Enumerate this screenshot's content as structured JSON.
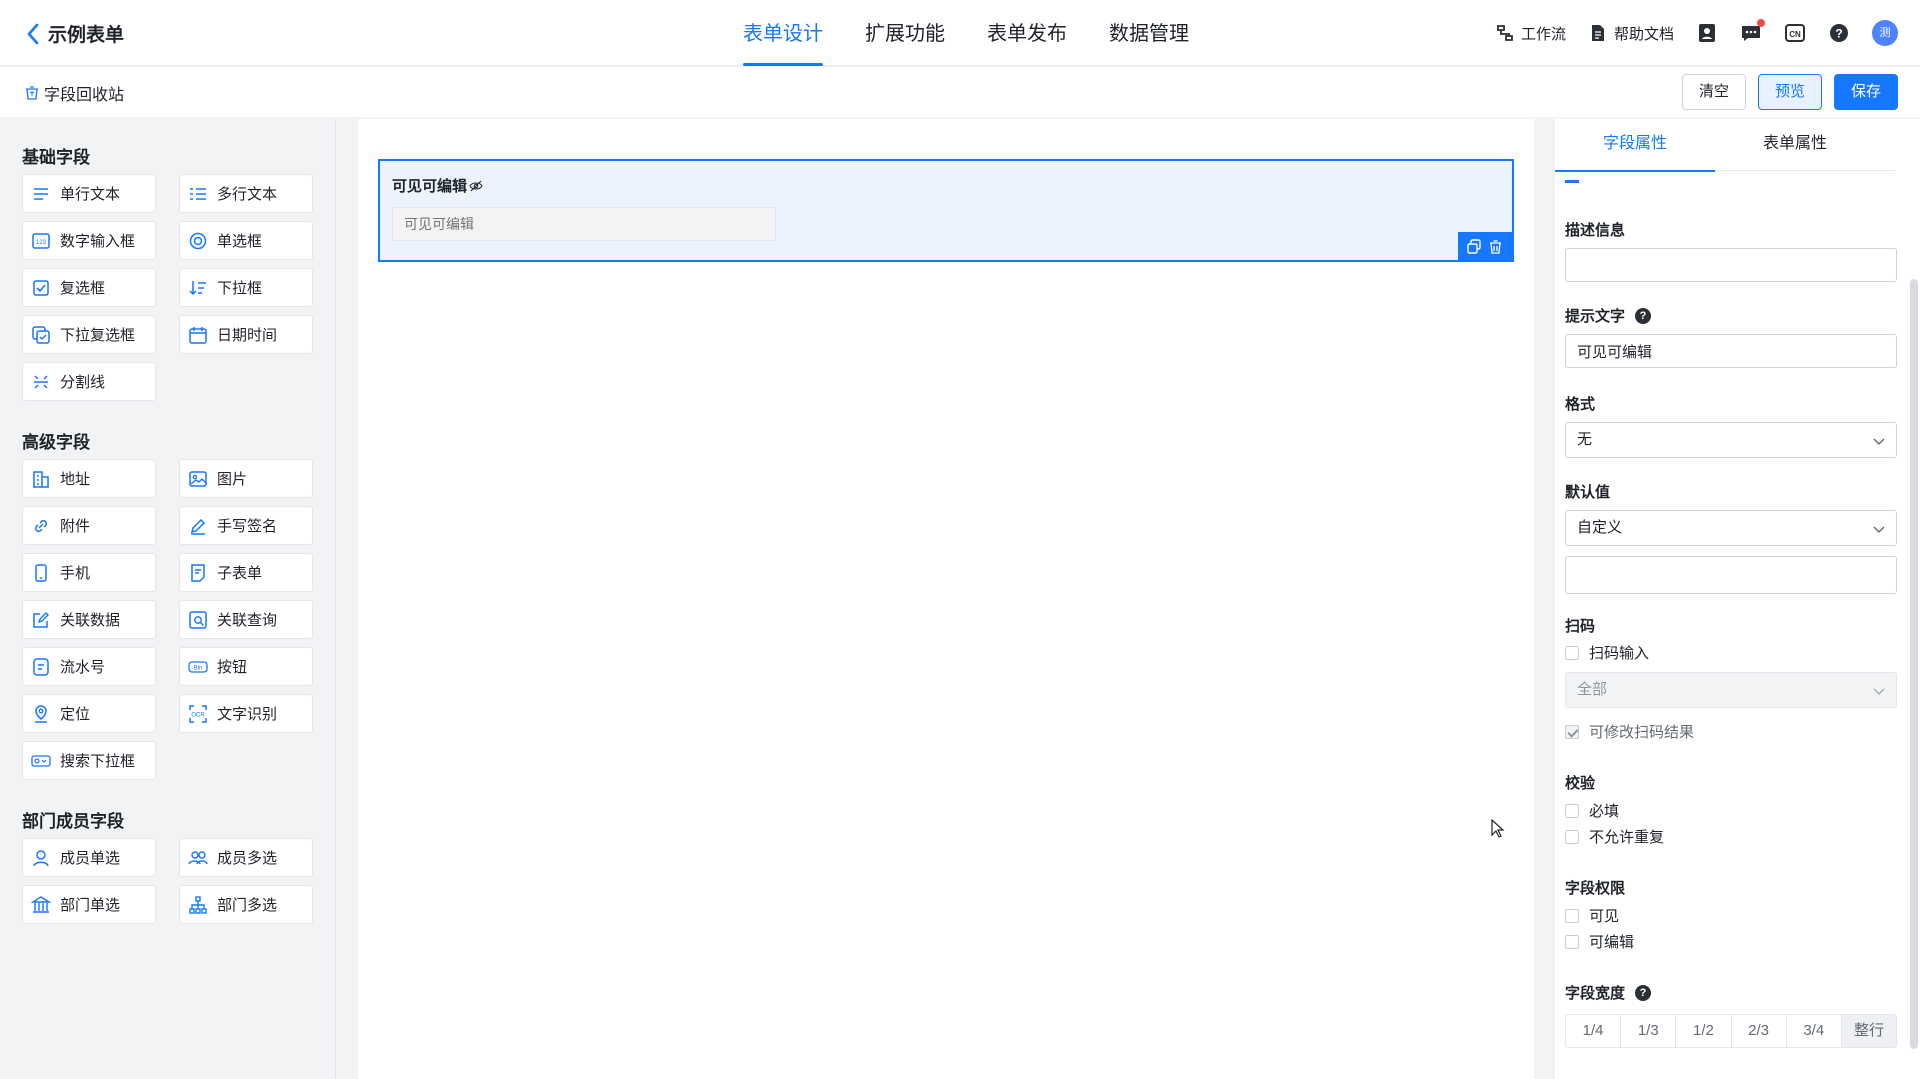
{
  "app": {
    "back_label": "示例表单"
  },
  "nav": {
    "tabs": [
      {
        "label": "表单设计"
      },
      {
        "label": "扩展功能"
      },
      {
        "label": "表单发布"
      },
      {
        "label": "数据管理"
      }
    ]
  },
  "topright": {
    "workflow": "工作流",
    "help_docs": "帮助文档",
    "lang_badge": "CN",
    "avatar_text": "测"
  },
  "subbar": {
    "recycle_label": "字段回收站",
    "clear": "清空",
    "preview": "预览",
    "save": "保存"
  },
  "left": {
    "basic_title": "基础字段",
    "basic": [
      "单行文本",
      "多行文本",
      "数字输入框",
      "单选框",
      "复选框",
      "下拉框",
      "下拉复选框",
      "日期时间",
      "分割线"
    ],
    "advanced_title": "高级字段",
    "advanced": [
      "地址",
      "图片",
      "附件",
      "手写签名",
      "手机",
      "子表单",
      "关联数据",
      "关联查询",
      "流水号",
      "按钮",
      "定位",
      "文字识别",
      "搜索下拉框"
    ],
    "member_title": "部门成员字段",
    "member": [
      "成员单选",
      "成员多选",
      "部门单选",
      "部门多选"
    ]
  },
  "canvas": {
    "field_title": "可见可编辑",
    "field_placeholder": "可见可编辑"
  },
  "right": {
    "tabs": [
      "字段属性",
      "表单属性"
    ],
    "desc_label": "描述信息",
    "desc_value": "",
    "hint_label": "提示文字",
    "hint_value": "可见可编辑",
    "format_label": "格式",
    "format_value": "无",
    "default_label": "默认值",
    "default_value": "自定义",
    "default_custom": "",
    "scan_label": "扫码",
    "scan_input": "扫码输入",
    "scan_scope": "全部",
    "scan_modify": "可修改扫码结果",
    "validate_label": "校验",
    "required": "必填",
    "no_duplicate": "不允许重复",
    "perm_label": "字段权限",
    "visible": "可见",
    "editable": "可编辑",
    "width_label": "字段宽度",
    "widths": [
      "1/4",
      "1/3",
      "1/2",
      "2/3",
      "3/4",
      "整行"
    ]
  },
  "colors": {
    "primary": "#1677ff",
    "selected_bg": "#ebf3ff",
    "page_bg": "#f2f3f5"
  }
}
